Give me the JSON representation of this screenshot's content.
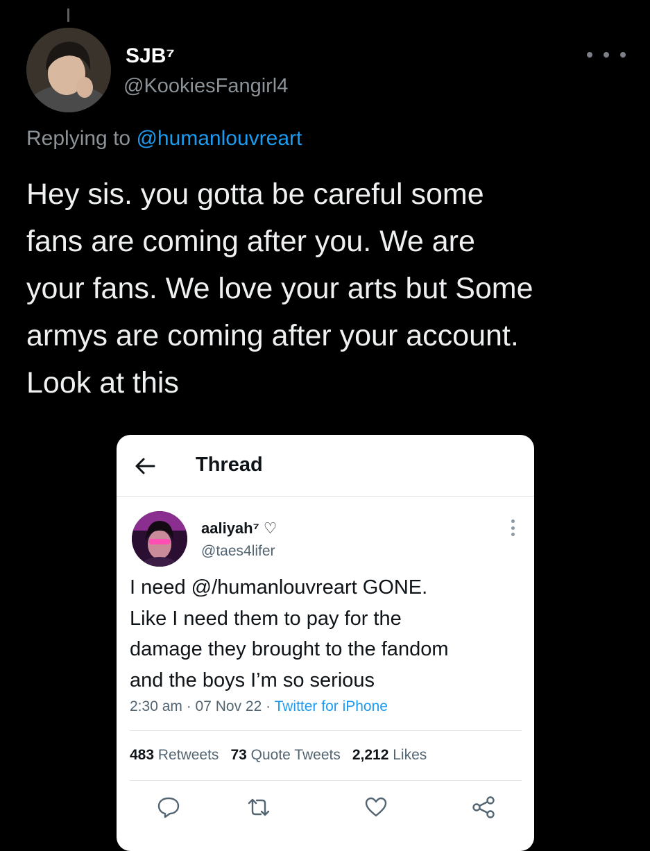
{
  "tweet": {
    "author_name": "SJB⁷",
    "author_handle": "@KookiesFangirl4",
    "replying_prefix": "Replying to ",
    "replying_to": "@humanlouvreart",
    "text_lines": [
      "Hey sis. you gotta be careful some",
      "fans are coming after you. We are",
      "your fans. We love your arts but Some",
      "armys are coming after your account.",
      "Look at this"
    ],
    "more_icon": "more-horizontal-icon"
  },
  "embedded": {
    "header_title": "Thread",
    "back_icon": "arrow-left-icon",
    "author_name": "aaliyah⁷ ♡",
    "author_handle": "@taes4lifer",
    "text_lines": [
      "I need @/humanlouvreart GONE.",
      "Like I need them to pay for the",
      "damage they brought to the fandom",
      "and the boys I’m so serious"
    ],
    "meta_time": "2:30 am · 07 Nov 22 · ",
    "meta_source": "Twitter for iPhone",
    "retweets_count": "483",
    "retweets_label": "Retweets",
    "quotes_count": "73",
    "quotes_label": "Quote Tweets",
    "likes_count": "2,212",
    "likes_label": "Likes",
    "actions": [
      "reply-icon",
      "retweet-icon",
      "like-icon",
      "share-icon"
    ]
  },
  "colors": {
    "background": "#000000",
    "link_blue": "#1d9bf0",
    "muted_gray": "#8b9298",
    "card_bg": "#ffffff"
  }
}
